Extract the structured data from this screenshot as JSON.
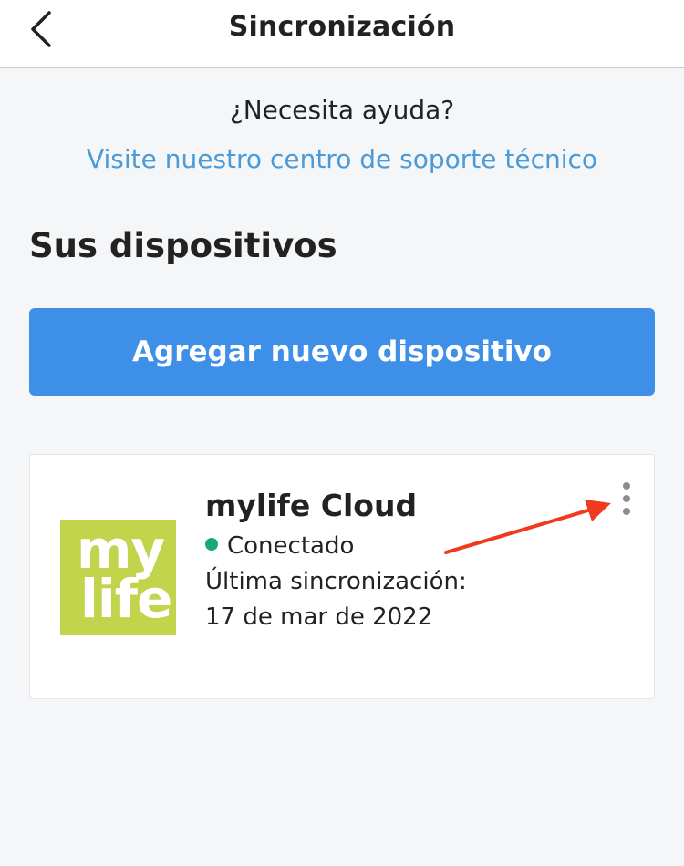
{
  "header": {
    "title": "Sincronización",
    "back_icon": "chevron-left-icon"
  },
  "help": {
    "question": "¿Necesita ayuda?",
    "link_text": "Visite nuestro centro de soporte técnico"
  },
  "devices_section": {
    "title": "Sus dispositivos",
    "add_button_label": "Agregar nuevo dispositivo"
  },
  "device": {
    "logo_text_line1": "my",
    "logo_text_line2": "life",
    "name": "mylife Cloud",
    "status": "Conectado",
    "sync_label": "Última sincronización:",
    "sync_date": "17 de mar de 2022",
    "menu_icon": "more-vertical-icon"
  },
  "colors": {
    "accent": "#3d8fe8",
    "link": "#4a9bd8",
    "status_connected": "#1aa77e",
    "logo_bg": "#c2d44b",
    "annotation_arrow": "#f03a1e"
  }
}
